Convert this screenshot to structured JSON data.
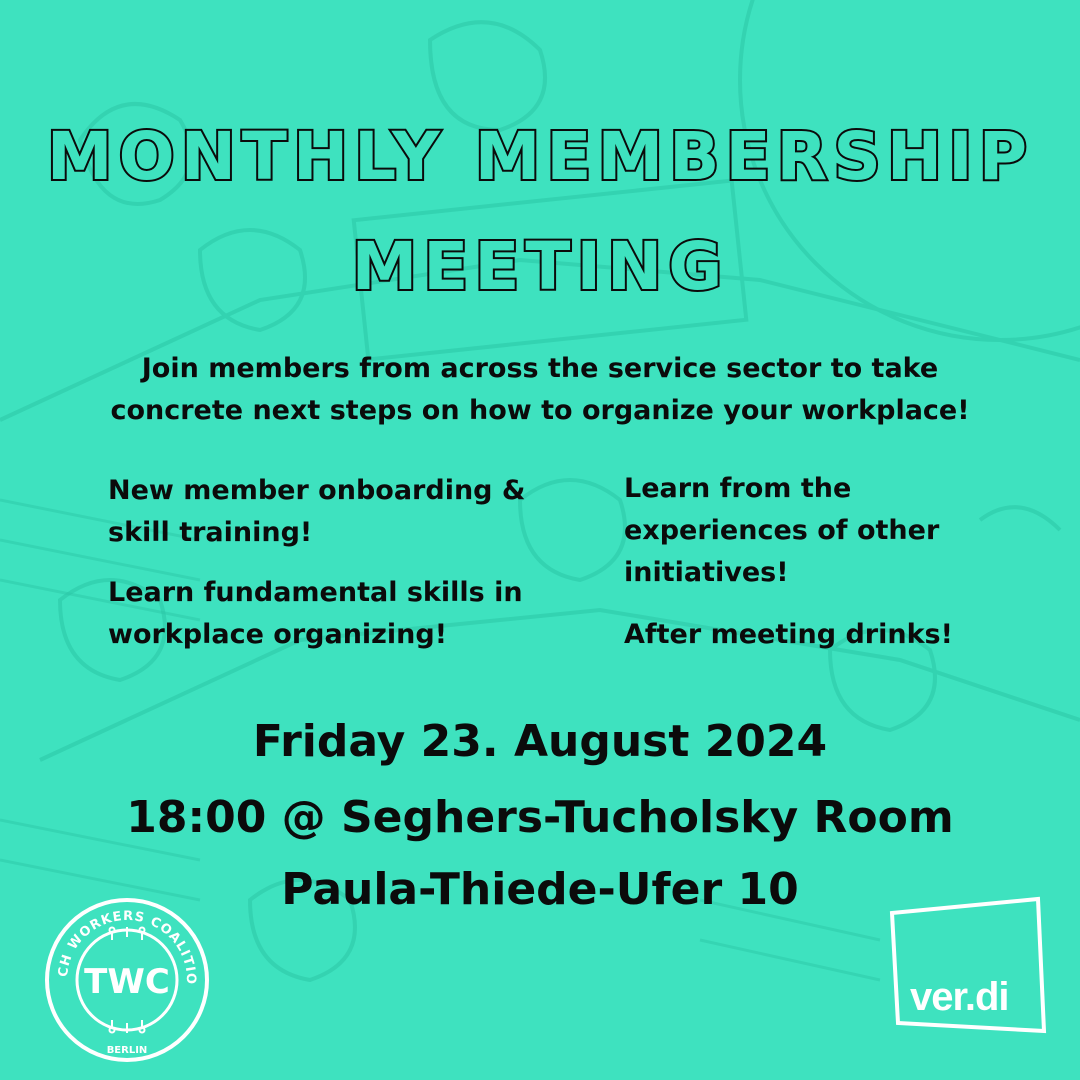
{
  "title": {
    "line1": "MONTHLY MEMBERSHIP",
    "line2": "MEETING"
  },
  "intro": {
    "line1": "Join members from across the service sector to take",
    "line2": "concrete next steps on how to organize your workplace!"
  },
  "bullets": {
    "left": [
      "New member onboarding & skill training!",
      "Learn fundamental skills in workplace organizing!"
    ],
    "right": [
      "Learn from the experiences of other initiatives!",
      "After meeting drinks!"
    ]
  },
  "event": {
    "date": "Friday 23. August 2024",
    "time_place": "18:00 @ Seghers-Tucholsky Room",
    "address": "Paula-Thiede-Ufer 10"
  },
  "logos": {
    "twc_ring_text": "TECH WORKERS COALITION",
    "twc_mark": "TWC",
    "twc_city": "BERLIN",
    "verdi": "ver.di"
  },
  "colors": {
    "background": "#3ee2bf",
    "ink": "#0b0b0b",
    "logo_white": "#ffffff"
  }
}
